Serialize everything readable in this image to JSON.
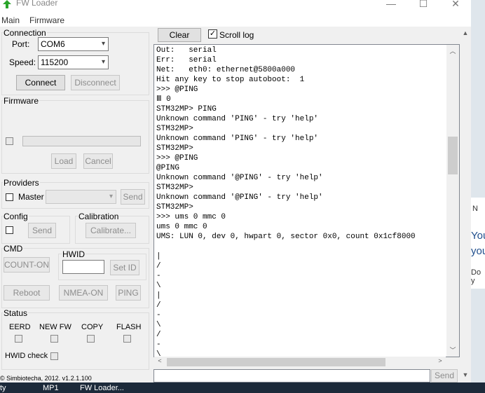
{
  "window": {
    "title": "FW Loader",
    "minimize": "—",
    "maximize": "☐",
    "close": "✕"
  },
  "menu": {
    "main": "Main",
    "firmware": "Firmware"
  },
  "connection": {
    "group_label": "Connection",
    "port_label": "Port:",
    "port_value": "COM6",
    "speed_label": "Speed:",
    "speed_value": "115200",
    "connect": "Connect",
    "disconnect": "Disconnect"
  },
  "firmware": {
    "group_label": "Firmware",
    "load": "Load",
    "cancel": "Cancel",
    "progress_percent": 0
  },
  "providers": {
    "group_label": "Providers",
    "master_label": "Master",
    "send": "Send"
  },
  "config": {
    "group_label": "Config",
    "send": "Send"
  },
  "calibration": {
    "group_label": "Calibration",
    "calibrate": "Calibrate..."
  },
  "cmd": {
    "group_label": "CMD",
    "count_on": "COUNT-ON"
  },
  "hwid": {
    "group_label": "HWID",
    "value": "",
    "set_id": "Set ID"
  },
  "buttons": {
    "reboot": "Reboot",
    "nmea_on": "NMEA-ON",
    "ping": "PING"
  },
  "status": {
    "group_label": "Status",
    "flags": [
      "EERD",
      "NEW FW",
      "COPY",
      "FLASH"
    ],
    "hwid_check": "HWID check"
  },
  "footer": "© Simbiotecha, 2012.  v1.2.1.100",
  "toolbar": {
    "clear": "Clear",
    "scroll_log": "Scroll log",
    "scroll_log_checked": true
  },
  "terminal": {
    "lines": [
      "Out:   serial",
      "Err:   serial",
      "Net:   eth0: ethernet@5800a000",
      "Hit any key to stop autoboot:  1",
      ">>> @PING",
      "Ⅲ 0",
      "STM32MP> PING",
      "Unknown command 'PING' - try 'help'",
      "STM32MP>",
      "Unknown command 'PING' - try 'help'",
      "STM32MP>",
      ">>> @PING",
      "@PING",
      "Unknown command '@PING' - try 'help'",
      "STM32MP>",
      "Unknown command '@PING' - try 'help'",
      "STM32MP>",
      ">>> ums 0 mmc 0",
      "ums 0 mmc 0",
      "UMS: LUN 0, dev 0, hwpart 0, sector 0x0, count 0x1cf8000",
      "",
      "|",
      "/",
      "-",
      "\\",
      "|",
      "/",
      "-",
      "\\",
      "/",
      "-",
      "\\"
    ]
  },
  "send_input": {
    "value": ""
  },
  "send_button": "Send",
  "background_dialog": {
    "text1": "N",
    "text2": "You",
    "text3": "you",
    "text4": "Do y"
  },
  "taskbar": {
    "item1": "ty",
    "item2": "MP1",
    "item3": "FW Loader..."
  }
}
